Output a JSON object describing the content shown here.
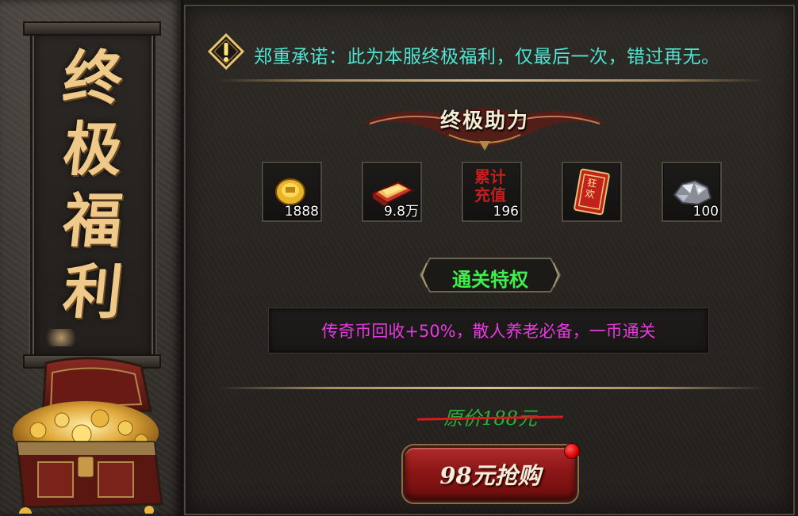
{
  "side_title": [
    "终",
    "极",
    "福",
    "利"
  ],
  "notice": {
    "icon": "warning-icon",
    "text": "郑重承诺：此为本服终极福利，仅最后一次，错过再无。"
  },
  "section_title": "终极助力",
  "rewards": [
    {
      "icon": "gold-ingot-icon",
      "count": "1888"
    },
    {
      "icon": "gold-bars-icon",
      "count": "9.8万"
    },
    {
      "icon": "recharge-icon",
      "label": "累计充值",
      "count": "196"
    },
    {
      "icon": "red-envelope-icon",
      "label": "狂欢",
      "count": ""
    },
    {
      "icon": "diamond-ore-icon",
      "count": "100"
    }
  ],
  "privilege": {
    "title": "通关特权",
    "description": "传奇币回收+50%，散人养老必备，一币通关"
  },
  "price": {
    "original": "原价188元",
    "buy_label": "98元抢购"
  },
  "colors": {
    "notice_text": "#4fe4d1",
    "privilege_title": "#40f04a",
    "description_text": "#e63ae0",
    "original_price": "#27b13b",
    "strike_line": "#d91a1a",
    "buy_button": "#8c1616"
  }
}
